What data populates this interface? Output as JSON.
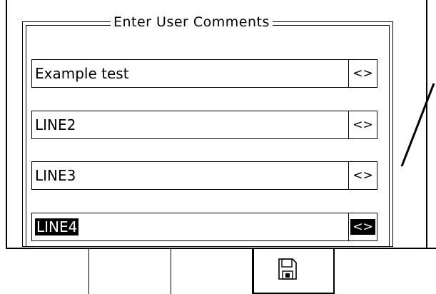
{
  "dialog": {
    "title": "Enter User Comments"
  },
  "fields": [
    {
      "value": "Example test",
      "toggle": "<>"
    },
    {
      "value": "LINE2",
      "toggle": "<>"
    },
    {
      "value": "LINE3",
      "toggle": "<>"
    },
    {
      "value": "LINE4",
      "toggle": "<>",
      "selected": true
    }
  ],
  "softkeys": [
    {
      "icon": ""
    },
    {
      "icon": ""
    },
    {
      "icon": ""
    },
    {
      "icon": "save-icon"
    },
    {
      "icon": ""
    }
  ]
}
